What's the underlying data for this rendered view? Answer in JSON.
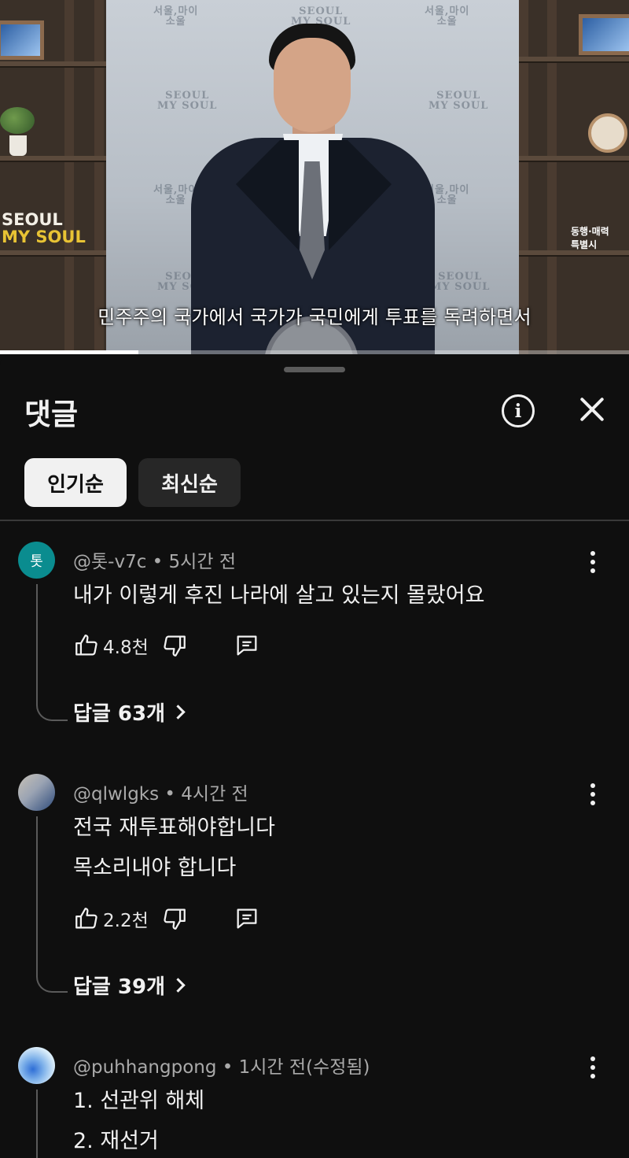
{
  "video": {
    "caption": "민주주의 국가에서 국가가 국민에게 투표를 독려하면서",
    "progress": 0.22,
    "backdrop_text": "SEOUL MY SOUL",
    "sign_text": [
      "SEOUL",
      "MY SOUL"
    ]
  },
  "panel": {
    "title": "댓글",
    "info_icon": "info-icon",
    "close_icon": "close-icon",
    "sort_chips": [
      {
        "label": "인기순",
        "active": true
      },
      {
        "label": "최신순",
        "active": false
      }
    ]
  },
  "comments": [
    {
      "avatar_letter": "톳",
      "avatar_color": "#0a8c8f",
      "author": "@톳-v7c",
      "time": "• 5시간 전",
      "lines": [
        "내가 이렇게 후진 나라에 살고 있는지 몰랐어요"
      ],
      "likes": "4.8천",
      "replies": "답글 63개"
    },
    {
      "avatar_letter": "",
      "avatar_color": "#8a95a8",
      "author": "@qlwlgks",
      "time": "• 4시간 전",
      "lines": [
        "전국 재투표해야합니다",
        "목소리내야 합니다"
      ],
      "likes": "2.2천",
      "replies": "답글 39개"
    },
    {
      "avatar_letter": "",
      "avatar_color": "#a9c6e8",
      "author": "@puhhangpong",
      "time": "• 1시간 전(수정됨)",
      "lines": [
        "1. 선관위 해체",
        "2. 재선거"
      ]
    }
  ],
  "colors": {
    "background": "#0f0f0f",
    "text": "#f1f1f1",
    "secondary_text": "#aaaaaa",
    "chip_idle": "#272727"
  }
}
